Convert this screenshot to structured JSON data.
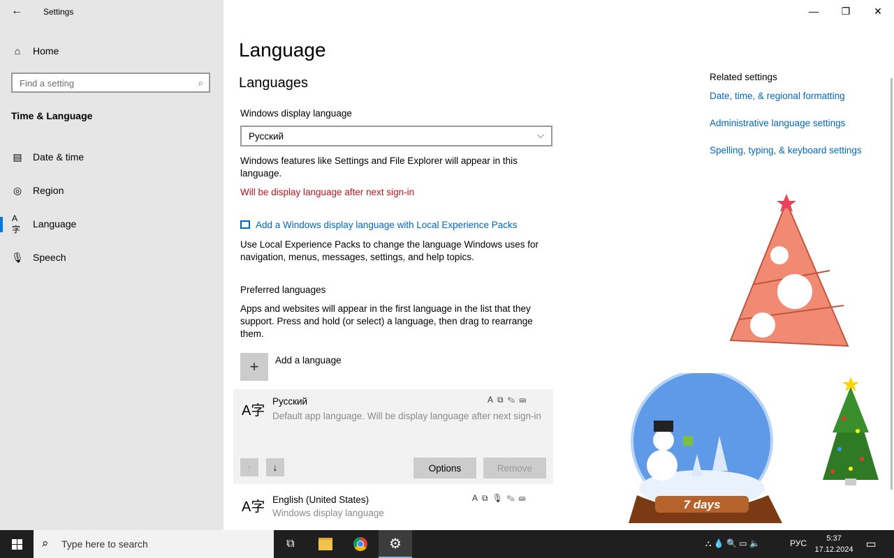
{
  "window": {
    "title": "Settings",
    "back_icon": "arrow-left-icon",
    "minimize": "–",
    "maximize": "❐",
    "close": "✕"
  },
  "sidebar": {
    "home_label": "Home",
    "search_placeholder": "Find a setting",
    "section_title": "Time & Language",
    "items": [
      {
        "label": "Date & time",
        "icon": "calendar-clock-icon"
      },
      {
        "label": "Region",
        "icon": "globe-icon"
      },
      {
        "label": "Language",
        "icon": "language-icon",
        "active": true
      },
      {
        "label": "Speech",
        "icon": "microphone-icon"
      }
    ]
  },
  "main": {
    "title": "Language",
    "section_languages": "Languages",
    "display_language_label": "Windows display language",
    "display_language_value": "Русский",
    "display_language_desc": "Windows features like Settings and File Explorer will appear in this language.",
    "display_language_notice": "Will be display language after next sign-in",
    "lxp_link": "Add a Windows display language with Local Experience Packs",
    "lxp_desc": "Use Local Experience Packs to change the language Windows uses for navigation, menus, messages, settings, and help topics.",
    "preferred_title": "Preferred languages",
    "preferred_desc": "Apps and websites will appear in the first language in the list that they support. Press and hold (or select) a language, then drag to rearrange them.",
    "add_language_label": "Add a language",
    "languages": [
      {
        "name": "Русский",
        "desc": "Default app language. Will be display language after next sign-in",
        "selected": true
      },
      {
        "name": "English (United States)",
        "desc": "Windows display language",
        "selected": false
      }
    ],
    "options_label": "Options",
    "remove_label": "Remove"
  },
  "related": {
    "title": "Related settings",
    "links": [
      "Date, time, & regional formatting",
      "Administrative language settings",
      "Spelling, typing, & keyboard settings"
    ]
  },
  "decor": {
    "globe_label": "7 days"
  },
  "taskbar": {
    "search_placeholder": "Type here to search",
    "lang_indicator": "РУС",
    "time": "5:37",
    "date": "17.12.2024"
  },
  "colors": {
    "accent": "#0078d7",
    "link": "#0067c0",
    "warning": "#c50f1f",
    "taskbar": "#1f1f1f"
  }
}
